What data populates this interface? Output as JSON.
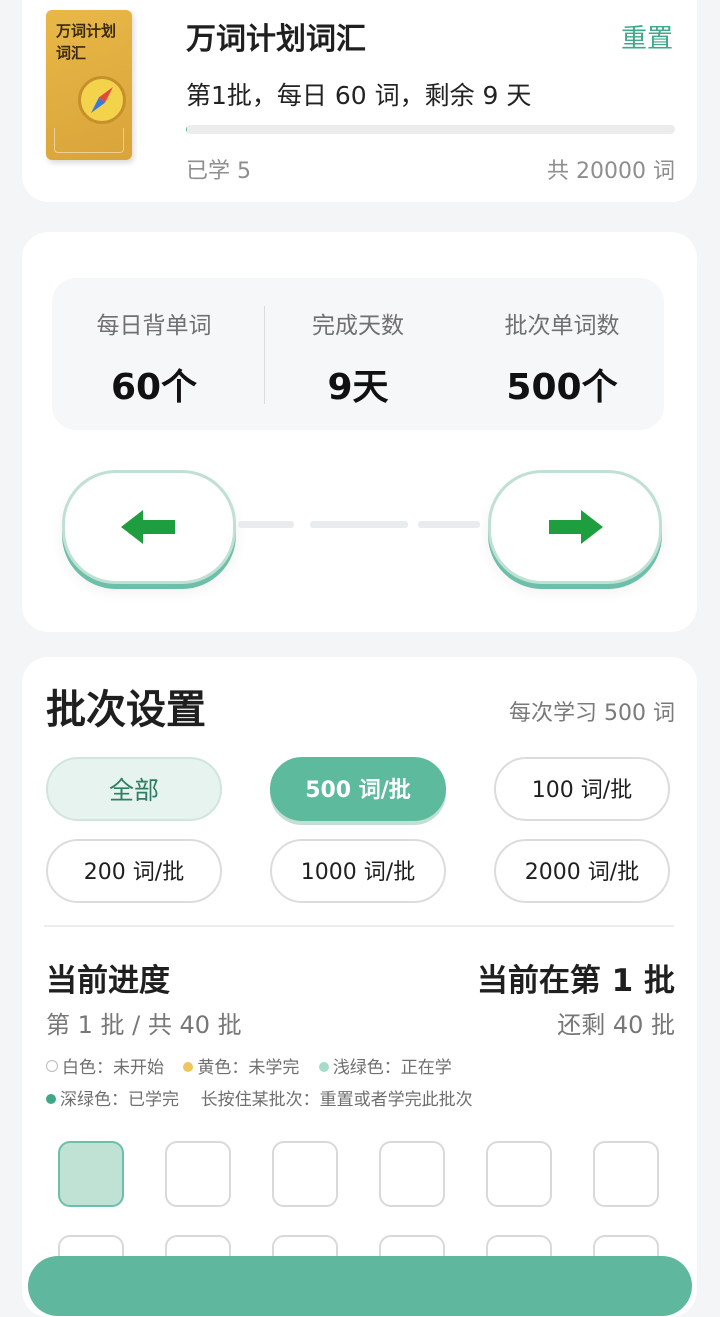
{
  "book": {
    "cover_text": "万词计划词汇",
    "title": "万词计划词汇",
    "reset_label": "重置",
    "plan_line": "第1批，每日 60 词，剩余 9 天",
    "learned": "已学 5",
    "total": "共 20000 词",
    "progress_fraction": 0.00025
  },
  "stats": [
    {
      "label": "每日背单词",
      "value": "60个"
    },
    {
      "label": "完成天数",
      "value": "9天"
    },
    {
      "label": "批次单词数",
      "value": "500个"
    }
  ],
  "nav": {
    "prev_icon": "arrow-left-icon",
    "next_icon": "arrow-right-icon"
  },
  "batch": {
    "title": "批次设置",
    "note": "每次学习 500 词",
    "options": [
      "全部",
      "500 词/批",
      "100 词/批",
      "200 词/批",
      "1000 词/批",
      "2000 词/批"
    ],
    "selected_index": 1
  },
  "progress": {
    "title": "当前进度",
    "current": "当前在第 1 批",
    "sub": "第 1 批 / 共 40 批",
    "remain": "还剩 40 批",
    "legend_line1": [
      {
        "color": "#ffffff",
        "text": "白色：未开始"
      },
      {
        "color": "#f0c659",
        "text": "黄色：未学完"
      },
      {
        "color": "#a7dcc8",
        "text": "浅绿色：正在学"
      }
    ],
    "legend_line2_dot_color": "#3fa887",
    "legend_line2": "深绿色：已学完    长按住某批次：重置或者学完此批次"
  },
  "colors": {
    "accent": "#5fb89d",
    "accent_text": "#3fa887"
  }
}
